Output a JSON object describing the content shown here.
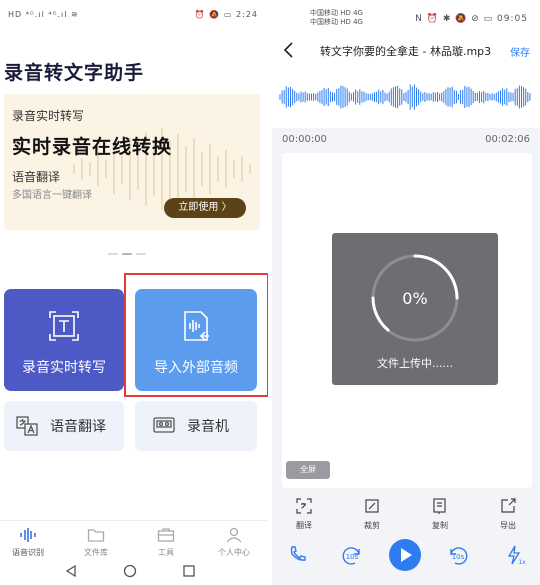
{
  "left": {
    "status_left": "HD ⁴ᴳ.ıl ⁴ᴳ.ıl ≋",
    "status_right": "⏰ 🔕 ▭ 2:24",
    "app_title": "录音转文字助手",
    "banner": {
      "line1": "录音实时转写",
      "headline": "实时录音在线转换",
      "line3": "语音翻译",
      "line4": "多国语言一键翻译",
      "button": "立即使用 〉"
    },
    "cards": {
      "realtime_label": "录音实时转写",
      "import_label": "导入外部音频"
    },
    "small_cards": {
      "translate_label": "语音翻译",
      "recorder_label": "录音机"
    },
    "tabs": [
      {
        "label": "语音识别",
        "icon": "waveform-icon"
      },
      {
        "label": "文件库",
        "icon": "folder-icon"
      },
      {
        "label": "工具",
        "icon": "toolbox-icon"
      },
      {
        "label": "个人中心",
        "icon": "user-icon"
      }
    ],
    "colors": {
      "realtime_card": "#4d59c4",
      "import_card": "#5b9cee",
      "highlight": "#e23a3a",
      "banner_button": "#5b4217"
    }
  },
  "right": {
    "status_left_1": "中国移动 HD 4G",
    "status_left_2": "中国移动 HD 4G",
    "status_right": "N ⏰ ✱ 🔕 ⊘ ▭ 09:05",
    "title": "转文字你要的全拿走 - 林品璇.mp3",
    "save_label": "保存",
    "time_start": "00:00:00",
    "time_end": "00:02:06",
    "progress_percent": "0%",
    "progress_value": 0,
    "upload_message": "文件上传中......",
    "fullscreen_label": "全屏",
    "tools": [
      {
        "label": "翻译",
        "icon": "translate-icon"
      },
      {
        "label": "裁剪",
        "icon": "crop-icon"
      },
      {
        "label": "复制",
        "icon": "copy-icon"
      },
      {
        "label": "导出",
        "icon": "export-icon"
      }
    ],
    "rewind_label": "10s",
    "forward_label": "10s",
    "speed_label": "1x",
    "colors": {
      "accent": "#2f7cf0",
      "overlay": "#6d6e72"
    }
  }
}
